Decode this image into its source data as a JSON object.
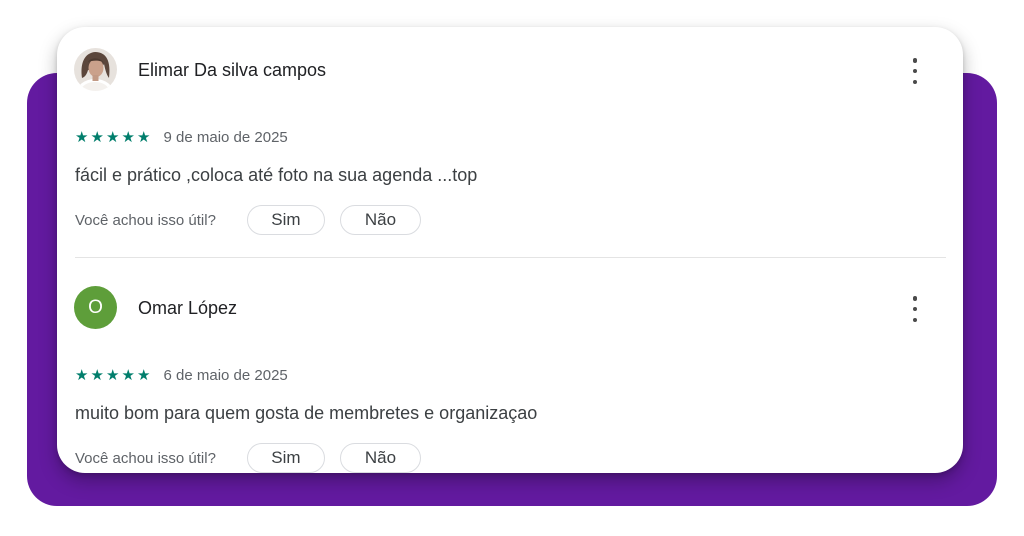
{
  "colors": {
    "backdrop": "#631aa0",
    "star": "#017e6c",
    "avatar_letter_bg": "#5e9e3a"
  },
  "reviews": [
    {
      "author": "Elimar Da silva campos",
      "avatar": "photo",
      "stars": 5,
      "date": "9 de maio de 2025",
      "text": "fácil e prático ,coloca até foto na sua agenda ...top",
      "helpful_question": "Você achou isso útil?",
      "yes_label": "Sim",
      "no_label": "Não"
    },
    {
      "author": "Omar López",
      "avatar_letter": "O",
      "stars": 5,
      "date": "6 de maio de 2025",
      "text": "muito bom para quem gosta de membretes e organizaçao",
      "helpful_question": "Você achou isso útil?",
      "yes_label": "Sim",
      "no_label": "Não"
    }
  ],
  "icons": {
    "star": "star-icon",
    "more": "more-vert-icon"
  }
}
